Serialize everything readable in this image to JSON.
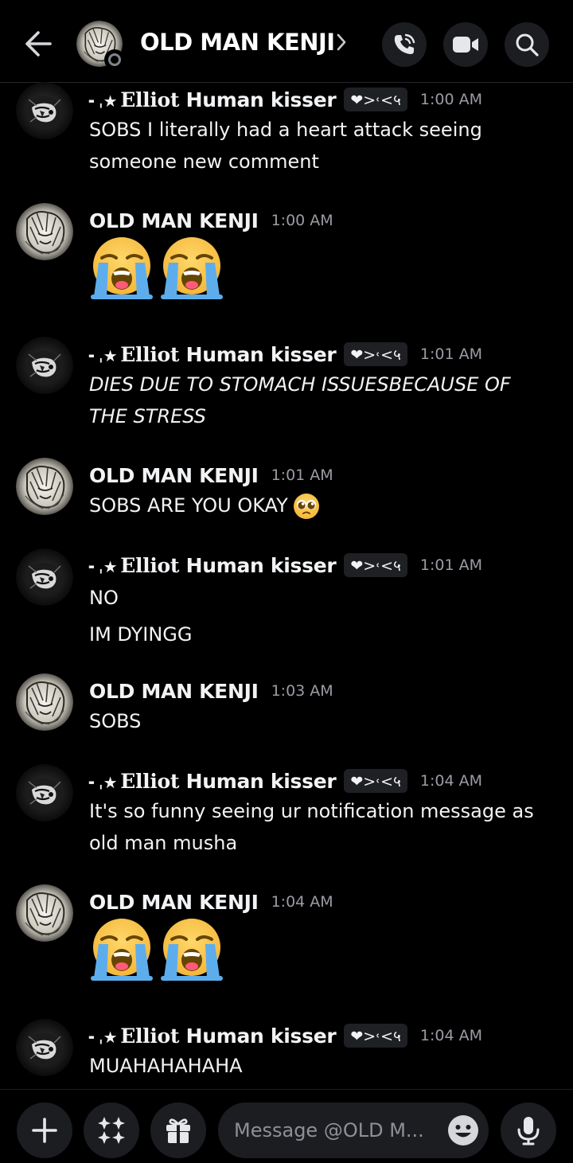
{
  "header": {
    "title": "OLD MAN KENJI",
    "back_icon": "arrow-left-icon",
    "call_icon": "phone-icon",
    "video_icon": "video-icon",
    "search_icon": "search-icon"
  },
  "users": {
    "elliot": {
      "decor": "╸ˌ★",
      "fancy": "Elliot",
      "rest": "Human kisser",
      "tag": "❤>˓<५"
    },
    "kenji": {
      "name": "OLD MAN KENJI"
    }
  },
  "messages": [
    {
      "user": "elliot",
      "time": "1:00 AM",
      "lines": [
        "SOBS I literally had a heart attack seeing",
        "someone new comment"
      ]
    },
    {
      "user": "kenji",
      "time": "1:00 AM",
      "emoji": "loudly-crying-face x2"
    },
    {
      "user": "elliot",
      "time": "1:01 AM",
      "lines": [
        "DIES DUE TO STOMACH ISSUESBECAUSE OF",
        "THE STRESS"
      ]
    },
    {
      "user": "kenji",
      "time": "1:01 AM",
      "lines": [
        "SOBS ARE YOU OKAY"
      ],
      "inline_emoji": "pleading-face"
    },
    {
      "user": "elliot",
      "time": "1:01 AM",
      "lines": [
        "NO",
        "IM DYINGG"
      ]
    },
    {
      "user": "kenji",
      "time": "1:03 AM",
      "lines": [
        "SOBS"
      ]
    },
    {
      "user": "elliot",
      "time": "1:04 AM",
      "lines": [
        "It's so funny seeing ur notification message as",
        "old man musha"
      ]
    },
    {
      "user": "kenji",
      "time": "1:04 AM",
      "emoji": "loudly-crying-face x2"
    },
    {
      "user": "elliot",
      "time": "1:04 AM",
      "lines": [
        "MUAHAHAHAHA"
      ]
    }
  ],
  "composer": {
    "placeholder": "Message @OLD M...",
    "add_icon": "plus-icon",
    "apps_icon": "apps-icon",
    "gift_icon": "gift-icon",
    "emoji_icon": "smile-icon",
    "mic_icon": "microphone-icon"
  },
  "colors": {
    "background": "#000000",
    "surface": "#1c1d21",
    "text": "#f2f3f5",
    "muted": "#9b9ca3",
    "emoji_yellow": "#ffcc4d",
    "tears": "#5dadec"
  }
}
